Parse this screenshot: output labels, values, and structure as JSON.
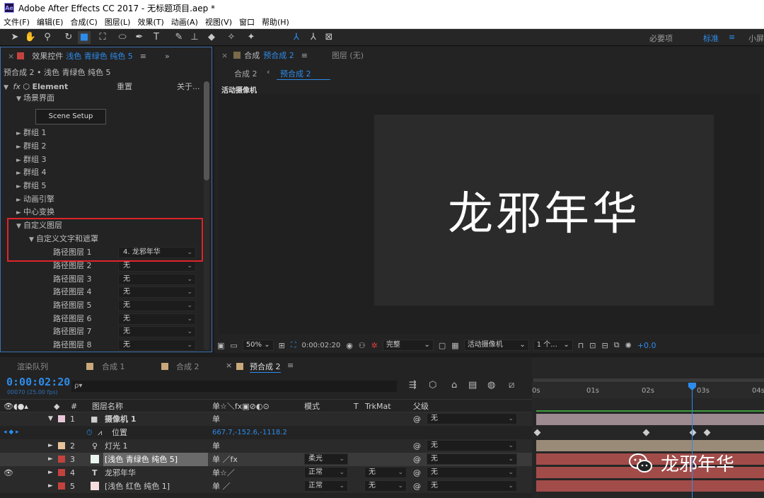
{
  "app": {
    "title": "Adobe After Effects CC 2017 - 无标题项目.aep *",
    "logo_text": "Ae"
  },
  "menu": [
    "文件(F)",
    "编辑(E)",
    "合成(C)",
    "图层(L)",
    "效果(T)",
    "动画(A)",
    "视图(V)",
    "窗口",
    "帮助(H)"
  ],
  "workspaces": {
    "essentials": "必要项",
    "standard": "标准",
    "standard_menu": "≡",
    "small": "小屏"
  },
  "effect_controls": {
    "tab_prefix": "效果控件",
    "tab_layer": "浅色 青绿色 纯色 5",
    "breadcrumb": "预合成 2 • 浅色 青绿色 纯色 5",
    "fx_label": "fx",
    "effect_name": "Element",
    "reset": "重置",
    "about": "关于...",
    "scene_interface": "场景界面",
    "scene_setup": "Scene Setup",
    "groups": [
      "群组 1",
      "群组 2",
      "群组 3",
      "群组 4",
      "群组 5"
    ],
    "anim_engine": "动画引擎",
    "center_transform": "中心变换",
    "custom_layers": "自定义图层",
    "custom_text_mask": "自定义文字和遮罩",
    "path_layers": [
      {
        "label": "路径图层 1",
        "value": "4. 龙邪年华"
      },
      {
        "label": "路径图层 2",
        "value": "无"
      },
      {
        "label": "路径图层 3",
        "value": "无"
      },
      {
        "label": "路径图层 4",
        "value": "无"
      },
      {
        "label": "路径图层 5",
        "value": "无"
      },
      {
        "label": "路径图层 6",
        "value": "无"
      },
      {
        "label": "路径图层 7",
        "value": "无"
      },
      {
        "label": "路径图层 8",
        "value": "无"
      }
    ]
  },
  "composition": {
    "tab_prefix": "合成",
    "tab_name": "预合成 2",
    "tab_menu": "≡",
    "layer_tab": "图层 (无)",
    "crumbs": [
      "合成 2",
      "预合成 2"
    ],
    "view_label": "活动摄像机",
    "canvas_text": "龙邪年华",
    "zoom": "50%",
    "timecode": "0:00:02:20",
    "quality": "完整",
    "camera": "活动摄像机",
    "views": "1 个...",
    "exposure": "+0.0"
  },
  "timeline": {
    "tabs": [
      "渲染队列",
      "合成 1",
      "合成 2",
      "预合成 2"
    ],
    "timecode": "0:00:02:20",
    "frame_info": "00070 (25.00 fps)",
    "search_placeholder": "ρ▾",
    "headers": {
      "num": "#",
      "name": "图层名称",
      "switches": "单☆＼fx▣⊘◐⊙",
      "mode": "模式",
      "t": "T",
      "trkmat": "TrkMat",
      "parent": "父级"
    },
    "layers": [
      {
        "num": "1",
        "name": "摄像机 1",
        "type_icon": "camera-icon",
        "color": "#e8c6d8",
        "mode": "",
        "trkmat": "",
        "parent": "无"
      },
      {
        "num": "2",
        "name": "灯光 1",
        "type_icon": "light-icon",
        "color": "#e7c39a",
        "mode": "",
        "trkmat": "",
        "parent": "无"
      },
      {
        "num": "3",
        "name": "[浅色 青绿色 纯色 5]",
        "type_icon": "solid-icon",
        "color": "#c4423e",
        "mode": "柔光",
        "trkmat": "",
        "parent": "无"
      },
      {
        "num": "4",
        "name": "龙邪年华",
        "type_icon": "text-icon",
        "color": "#c4423e",
        "mode": "正常",
        "trkmat": "无",
        "parent": "无"
      },
      {
        "num": "5",
        "name": "[浅色 红色 纯色 1]",
        "type_icon": "solid-icon",
        "color": "#c4423e",
        "mode": "正常",
        "trkmat": "无",
        "parent": "无"
      }
    ],
    "position_label": "位置",
    "position_value": "667.7,-152.6,-1118.2",
    "ruler": [
      "0s",
      "01s",
      "02s",
      "03s",
      "04s"
    ]
  },
  "watermark": {
    "text": "龙邪年华"
  }
}
